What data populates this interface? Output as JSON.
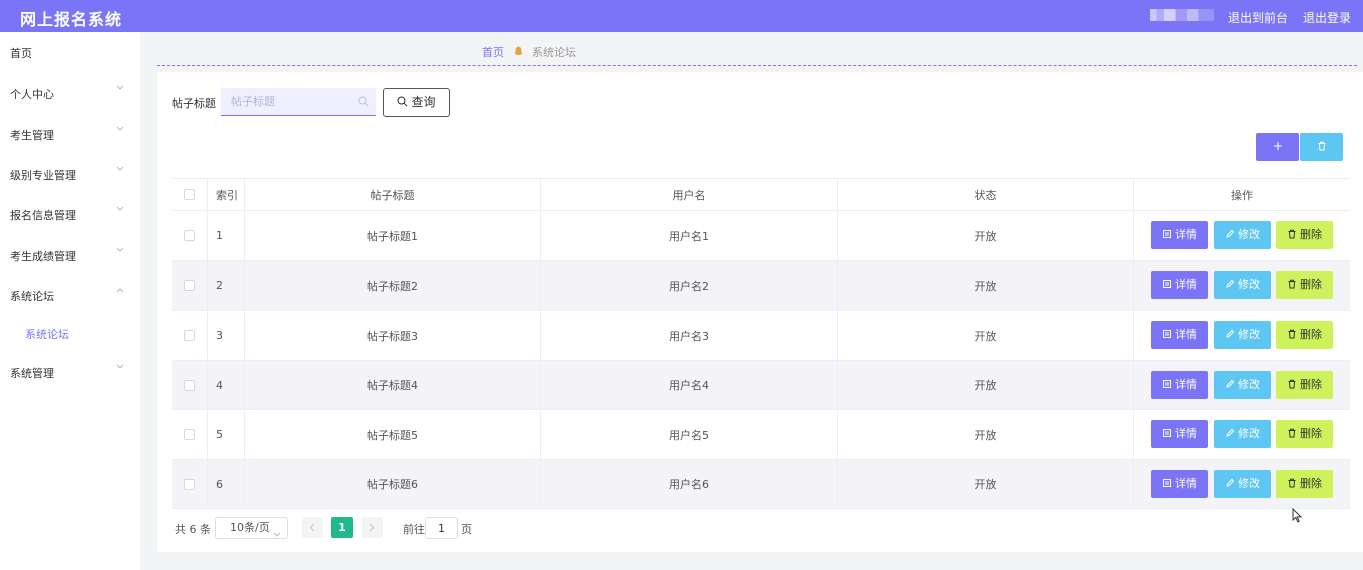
{
  "app": {
    "title": "网上报名系统"
  },
  "header": {
    "go_front": "退出到前台",
    "logout": "退出登录"
  },
  "sidebar": {
    "items": [
      {
        "label": "首页",
        "chevron": ""
      },
      {
        "label": "个人中心",
        "chevron": "down"
      },
      {
        "label": "考生管理",
        "chevron": "down"
      },
      {
        "label": "级别专业管理",
        "chevron": "down"
      },
      {
        "label": "报名信息管理",
        "chevron": "down"
      },
      {
        "label": "考生成绩管理",
        "chevron": "down"
      },
      {
        "label": "系统论坛",
        "chevron": "up"
      },
      {
        "label": "系统管理",
        "chevron": "down"
      }
    ],
    "sub_item": "系统论坛"
  },
  "breadcrumb": {
    "home": "首页",
    "current": "系统论坛"
  },
  "search": {
    "label": "帖子标题",
    "placeholder": "帖子标题",
    "button": "查询"
  },
  "toolbar": {
    "add_icon": "plus-icon",
    "delete_icon": "trash-icon"
  },
  "table": {
    "headers": {
      "index": "索引",
      "title": "帖子标题",
      "user": "用户名",
      "status": "状态",
      "ops": "操作"
    },
    "rows": [
      {
        "index": "1",
        "title": "帖子标题1",
        "user": "用户名1",
        "status": "开放"
      },
      {
        "index": "2",
        "title": "帖子标题2",
        "user": "用户名2",
        "status": "开放"
      },
      {
        "index": "3",
        "title": "帖子标题3",
        "user": "用户名3",
        "status": "开放"
      },
      {
        "index": "4",
        "title": "帖子标题4",
        "user": "用户名4",
        "status": "开放"
      },
      {
        "index": "5",
        "title": "帖子标题5",
        "user": "用户名5",
        "status": "开放"
      },
      {
        "index": "6",
        "title": "帖子标题6",
        "user": "用户名6",
        "status": "开放"
      }
    ],
    "actions": {
      "detail": "详情",
      "edit": "修改",
      "delete": "删除"
    }
  },
  "pagination": {
    "total": "共 6 条",
    "page_size": "10条/页",
    "current_page": "1",
    "goto_label": "前往",
    "goto_value": "1",
    "page_suffix": "页"
  },
  "colors": {
    "primary": "#7b74f7",
    "info": "#5ec6f2",
    "warning": "#cef25c",
    "page_active": "#1fb98c"
  }
}
